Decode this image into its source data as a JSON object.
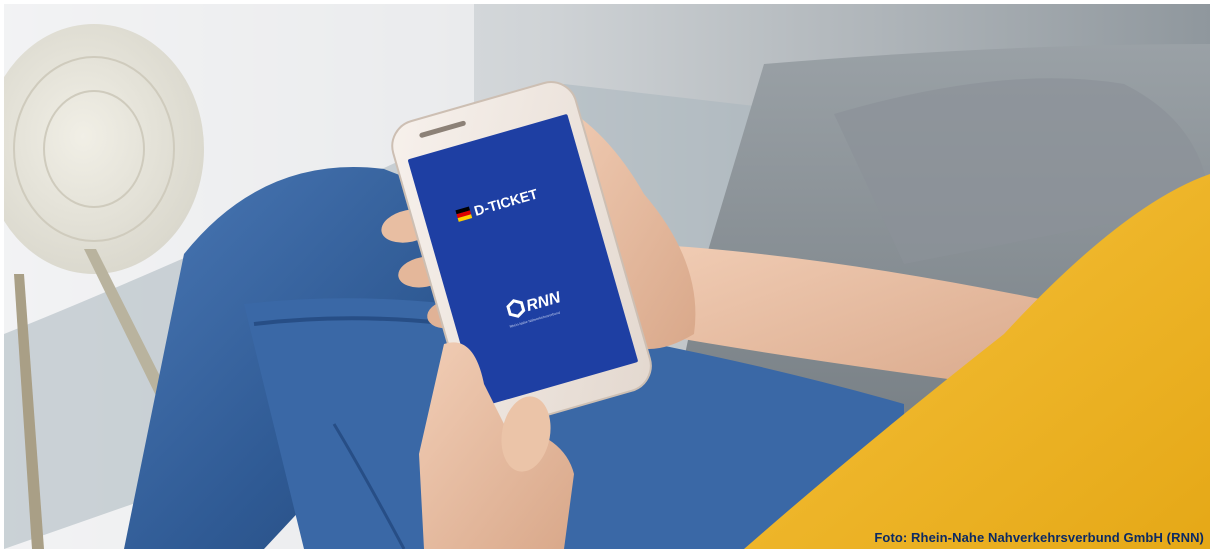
{
  "photo": {
    "screen_title": "D-TICKET",
    "screen_logo": "RNN",
    "screen_logo_subline": "Rhein-Nahe Nahverkehrsverbund",
    "screen_color": "#1e3fa3",
    "flag_colors": [
      "#000000",
      "#dd0000",
      "#ffce00"
    ]
  },
  "caption": {
    "credit": "Foto: Rhein-Nahe Nahverkehrsverbund GmbH (RNN)"
  }
}
